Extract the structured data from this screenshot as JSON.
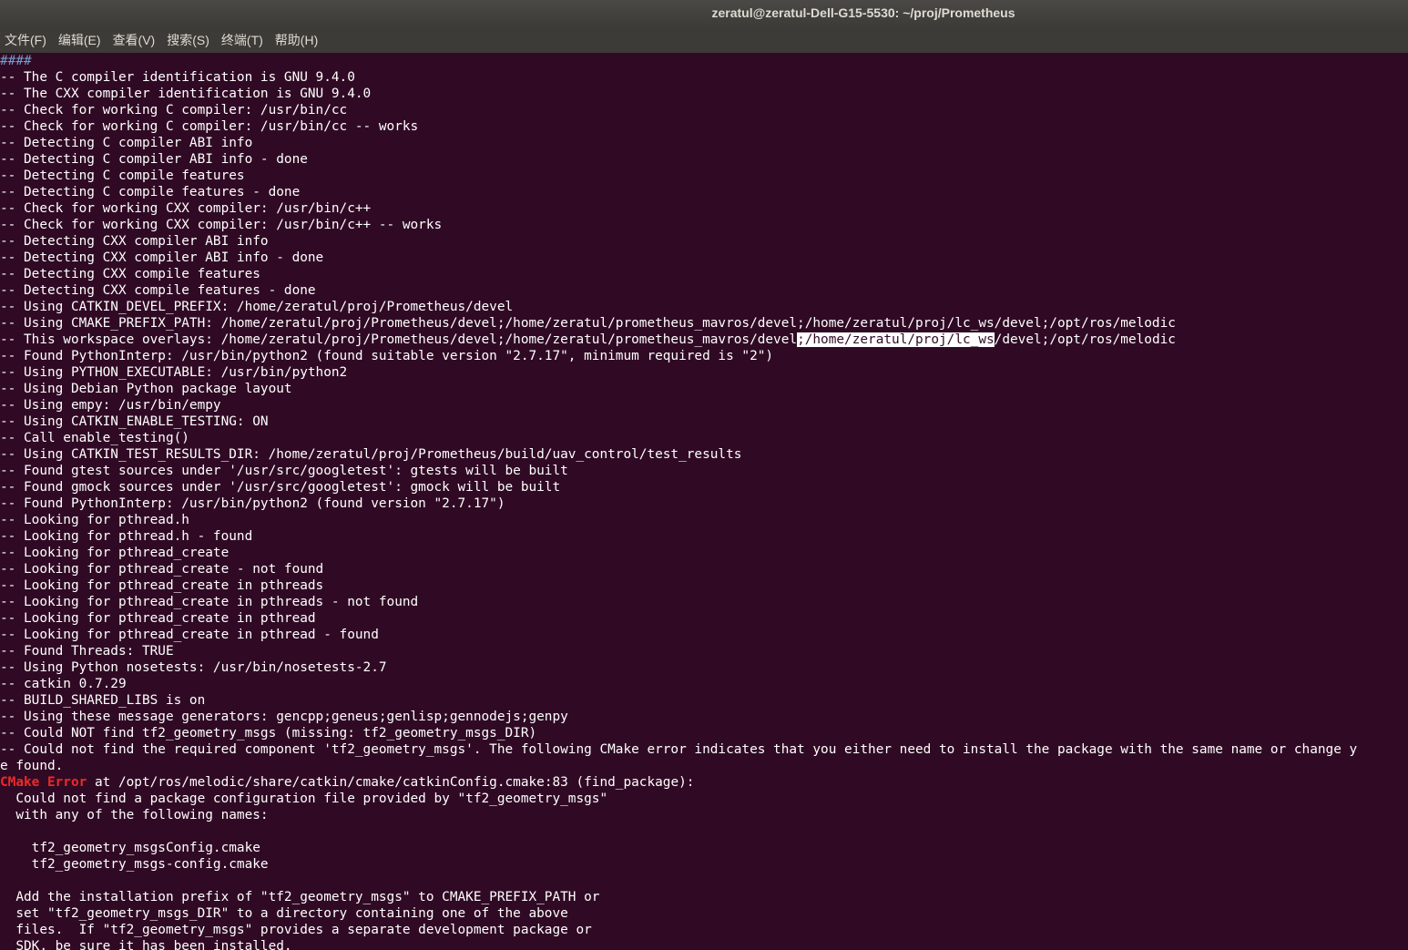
{
  "window": {
    "title": "zeratul@zeratul-Dell-G15-5530: ~/proj/Prometheus"
  },
  "menu": [
    "文件(F)",
    "编辑(E)",
    "查看(V)",
    "搜索(S)",
    "终端(T)",
    "帮助(H)"
  ],
  "colors": {
    "background": "#300a24",
    "foreground": "#ffffff",
    "error": "#ef2929",
    "marker": "#729fcf"
  },
  "terminal": {
    "lines": [
      "####",
      "-- The C compiler identification is GNU 9.4.0",
      "-- The CXX compiler identification is GNU 9.4.0",
      "-- Check for working C compiler: /usr/bin/cc",
      "-- Check for working C compiler: /usr/bin/cc -- works",
      "-- Detecting C compiler ABI info",
      "-- Detecting C compiler ABI info - done",
      "-- Detecting C compile features",
      "-- Detecting C compile features - done",
      "-- Check for working CXX compiler: /usr/bin/c++",
      "-- Check for working CXX compiler: /usr/bin/c++ -- works",
      "-- Detecting CXX compiler ABI info",
      "-- Detecting CXX compiler ABI info - done",
      "-- Detecting CXX compile features",
      "-- Detecting CXX compile features - done",
      "-- Using CATKIN_DEVEL_PREFIX: /home/zeratul/proj/Prometheus/devel",
      "-- Using CMAKE_PREFIX_PATH: /home/zeratul/proj/Prometheus/devel;/home/zeratul/prometheus_mavros/devel;/home/zeratul/proj/lc_ws/devel;/opt/ros/melodic",
      "-- This workspace overlays: /home/zeratul/proj/Prometheus/devel;/home/zeratul/prometheus_mavros/devel;/home/zeratul/proj/lc_ws/devel;/opt/ros/melodic",
      "-- Found PythonInterp: /usr/bin/python2 (found suitable version \"2.7.17\", minimum required is \"2\")",
      "-- Using PYTHON_EXECUTABLE: /usr/bin/python2",
      "-- Using Debian Python package layout",
      "-- Using empy: /usr/bin/empy",
      "-- Using CATKIN_ENABLE_TESTING: ON",
      "-- Call enable_testing()",
      "-- Using CATKIN_TEST_RESULTS_DIR: /home/zeratul/proj/Prometheus/build/uav_control/test_results",
      "-- Found gtest sources under '/usr/src/googletest': gtests will be built",
      "-- Found gmock sources under '/usr/src/googletest': gmock will be built",
      "-- Found PythonInterp: /usr/bin/python2 (found version \"2.7.17\")",
      "-- Looking for pthread.h",
      "-- Looking for pthread.h - found",
      "-- Looking for pthread_create",
      "-- Looking for pthread_create - not found",
      "-- Looking for pthread_create in pthreads",
      "-- Looking for pthread_create in pthreads - not found",
      "-- Looking for pthread_create in pthread",
      "-- Looking for pthread_create in pthread - found",
      "-- Found Threads: TRUE",
      "-- Using Python nosetests: /usr/bin/nosetests-2.7",
      "-- catkin 0.7.29",
      "-- BUILD_SHARED_LIBS is on",
      "-- Using these message generators: gencpp;geneus;genlisp;gennodejs;genpy",
      "-- Could NOT find tf2_geometry_msgs (missing: tf2_geometry_msgs_DIR)",
      "-- Could not find the required component 'tf2_geometry_msgs'. The following CMake error indicates that you either need to install the package with the same name or change y",
      "e found."
    ],
    "error_label": "CMake Error",
    "error_rest": " at /opt/ros/melodic/share/catkin/cmake/catkinConfig.cmake:83 (find_package):",
    "error_lines": [
      "  Could not find a package configuration file provided by \"tf2_geometry_msgs\"",
      "  with any of the following names:",
      "",
      "    tf2_geometry_msgsConfig.cmake",
      "    tf2_geometry_msgs-config.cmake",
      "",
      "  Add the installation prefix of \"tf2_geometry_msgs\" to CMAKE_PREFIX_PATH or",
      "  set \"tf2_geometry_msgs_DIR\" to a directory containing one of the above",
      "  files.  If \"tf2_geometry_msgs\" provides a separate development package or",
      "  SDK, be sure it has been installed."
    ],
    "selection": {
      "line": 17,
      "text": ";/home/zeratul/proj/lc_ws"
    }
  }
}
